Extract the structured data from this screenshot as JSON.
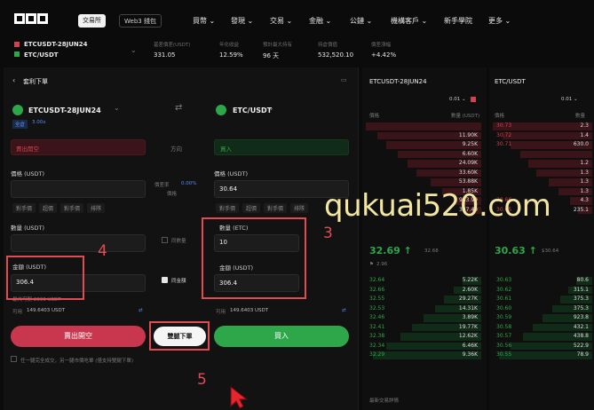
{
  "nav": {
    "tabs": [
      "交易所",
      "Web3 錢包"
    ],
    "items": [
      "買幣 ⌄",
      "發現 ⌄",
      "交易 ⌄",
      "金融 ⌄",
      "公鏈 ⌄",
      "機構客戶 ⌄",
      "新手學院",
      "更多 ⌄"
    ]
  },
  "ticker": {
    "pair1": "ETCUSDT-28JUN24",
    "pair2": "ETC/USDT",
    "stats": [
      {
        "label": "基差價差(USDT)",
        "value": "331.05"
      },
      {
        "label": "年化收益",
        "value": "12.59%"
      },
      {
        "label": "預計最大持有",
        "value": "96 天"
      },
      {
        "label": "持倉價值",
        "value": "532,520.10"
      },
      {
        "label": "價差漲幅",
        "value": "+4.42%"
      }
    ]
  },
  "panel": {
    "title": "套利下單",
    "left_pair": "ETCUSDT-28JUN24",
    "left_tags": [
      "全倉",
      "3.00x"
    ],
    "left_side": "賣出開空",
    "direction_label": "方向",
    "left_price_label": "價格 (USDT)",
    "left_shortcuts": [
      "對手價",
      "超價",
      "對手價",
      "排隊"
    ],
    "spread_label": "價差率",
    "spread_value": "0.00%",
    "spread_sub": "價格",
    "left_qty_label": "數量 (USDT)",
    "sync_qty_label": "同數量",
    "left_amount_label": "金額 (USDT)",
    "left_amount_value": "306.4",
    "left_avail_max": "最大可開 2000 USDT",
    "left_avail_label": "可用",
    "left_avail_value": "149.6403 USDT",
    "sync_amount_label": "同金額",
    "right_pair": "ETC/USDT",
    "right_side": "買入",
    "right_price_label": "價格 (USDT)",
    "right_price_value": "30.64",
    "right_shortcuts": [
      "對手價",
      "超價",
      "對手價",
      "排隊"
    ],
    "right_qty_label": "數量 (ETC)",
    "right_qty_value": "10",
    "right_amount_label": "金額 (USDT)",
    "right_amount_value": "306.4",
    "right_avail_label": "可用",
    "right_avail_value": "149.6403 USDT",
    "sell_button": "賣出開空",
    "both_button": "雙腿下單",
    "buy_button": "買入",
    "footer_note": "任一腿完全成交，另一腿市價吃單 (僅支持雙腿下單)"
  },
  "orderbook1": {
    "title": "ETCUSDT-28JUN24",
    "tick": "0.01 ⌄",
    "col_price": "價格",
    "col_qty": "數量 (USDT)",
    "asks": [
      [
        "",
        ""
      ],
      [
        "",
        "11.90K"
      ],
      [
        "",
        "9.25K"
      ],
      [
        "",
        "6.60K"
      ],
      [
        "",
        "24.09K"
      ],
      [
        "",
        "33.60K"
      ],
      [
        "",
        "53.88K"
      ],
      [
        "",
        "1.85K"
      ],
      [
        "",
        "983.99"
      ],
      [
        "",
        "327.40"
      ]
    ],
    "mid_price": "32.69",
    "mid_ref": "32.68",
    "mid_sub": "2.96",
    "bids": [
      [
        "32.64",
        "5.22K"
      ],
      [
        "32.66",
        "2.60K"
      ],
      [
        "32.55",
        "29.27K"
      ],
      [
        "32.53",
        "14.31K"
      ],
      [
        "32.46",
        "3.89K"
      ],
      [
        "32.41",
        "19.77K"
      ],
      [
        "32.38",
        "12.62K"
      ],
      [
        "32.34",
        "6.46K"
      ],
      [
        "32.29",
        "9.36K"
      ]
    ],
    "footer": "最新交易詳情"
  },
  "orderbook2": {
    "title": "ETC/USDT",
    "tick": "0.01 ⌄",
    "col_price": "價格",
    "col_qty": "數量",
    "asks": [
      [
        "30.73",
        "2.3"
      ],
      [
        "30.72",
        "1.4"
      ],
      [
        "30.71",
        "630.0"
      ],
      [
        "",
        ""
      ],
      [
        "",
        "1.2"
      ],
      [
        "",
        "1.3"
      ],
      [
        "",
        "1.3"
      ],
      [
        "",
        "1.3"
      ],
      [
        "30.66",
        "4.3"
      ],
      [
        "30.65",
        "235.1"
      ]
    ],
    "mid_price": "30.63",
    "mid_ref": "$30.64",
    "bids": [
      [
        "30.63",
        "80.6"
      ],
      [
        "30.62",
        "315.1"
      ],
      [
        "30.61",
        "375.3"
      ],
      [
        "30.60",
        "375.3"
      ],
      [
        "30.59",
        "923.8"
      ],
      [
        "30.58",
        "432.1"
      ],
      [
        "30.57",
        "438.8"
      ],
      [
        "30.56",
        "522.9"
      ],
      [
        "30.55",
        "78.9"
      ]
    ]
  },
  "watermark": "qukuai520.com",
  "annotations": [
    "4",
    "3",
    "5"
  ]
}
